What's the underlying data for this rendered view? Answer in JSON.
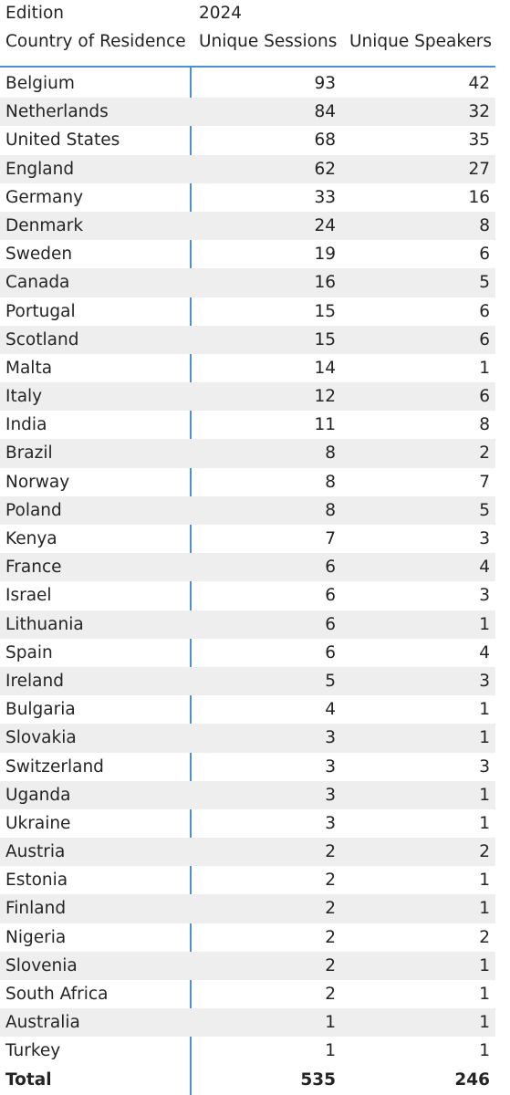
{
  "header": {
    "edition_label": "Edition",
    "edition_value": "2024",
    "columns": [
      "Country of Residence",
      "Unique Sessions",
      "Unique Speakers"
    ]
  },
  "colors": {
    "accent_line": "#4a90d9",
    "alt_row": "#eeeeee"
  },
  "rows": [
    {
      "country": "Belgium",
      "sessions": "93",
      "speakers": "42"
    },
    {
      "country": "Netherlands",
      "sessions": "84",
      "speakers": "32"
    },
    {
      "country": "United States",
      "sessions": "68",
      "speakers": "35"
    },
    {
      "country": "England",
      "sessions": "62",
      "speakers": "27"
    },
    {
      "country": "Germany",
      "sessions": "33",
      "speakers": "16"
    },
    {
      "country": "Denmark",
      "sessions": "24",
      "speakers": "8"
    },
    {
      "country": "Sweden",
      "sessions": "19",
      "speakers": "6"
    },
    {
      "country": "Canada",
      "sessions": "16",
      "speakers": "5"
    },
    {
      "country": "Portugal",
      "sessions": "15",
      "speakers": "6"
    },
    {
      "country": "Scotland",
      "sessions": "15",
      "speakers": "6"
    },
    {
      "country": "Malta",
      "sessions": "14",
      "speakers": "1"
    },
    {
      "country": "Italy",
      "sessions": "12",
      "speakers": "6"
    },
    {
      "country": "India",
      "sessions": "11",
      "speakers": "8"
    },
    {
      "country": "Brazil",
      "sessions": "8",
      "speakers": "2"
    },
    {
      "country": "Norway",
      "sessions": "8",
      "speakers": "7"
    },
    {
      "country": "Poland",
      "sessions": "8",
      "speakers": "5"
    },
    {
      "country": "Kenya",
      "sessions": "7",
      "speakers": "3"
    },
    {
      "country": "France",
      "sessions": "6",
      "speakers": "4"
    },
    {
      "country": "Israel",
      "sessions": "6",
      "speakers": "3"
    },
    {
      "country": "Lithuania",
      "sessions": "6",
      "speakers": "1"
    },
    {
      "country": "Spain",
      "sessions": "6",
      "speakers": "4"
    },
    {
      "country": "Ireland",
      "sessions": "5",
      "speakers": "3"
    },
    {
      "country": "Bulgaria",
      "sessions": "4",
      "speakers": "1"
    },
    {
      "country": "Slovakia",
      "sessions": "3",
      "speakers": "1"
    },
    {
      "country": "Switzerland",
      "sessions": "3",
      "speakers": "3"
    },
    {
      "country": "Uganda",
      "sessions": "3",
      "speakers": "1"
    },
    {
      "country": "Ukraine",
      "sessions": "3",
      "speakers": "1"
    },
    {
      "country": "Austria",
      "sessions": "2",
      "speakers": "2"
    },
    {
      "country": "Estonia",
      "sessions": "2",
      "speakers": "1"
    },
    {
      "country": "Finland",
      "sessions": "2",
      "speakers": "1"
    },
    {
      "country": "Nigeria",
      "sessions": "2",
      "speakers": "2"
    },
    {
      "country": "Slovenia",
      "sessions": "2",
      "speakers": "1"
    },
    {
      "country": "South Africa",
      "sessions": "2",
      "speakers": "1"
    },
    {
      "country": "Australia",
      "sessions": "1",
      "speakers": "1"
    },
    {
      "country": "Turkey",
      "sessions": "1",
      "speakers": "1"
    }
  ],
  "total": {
    "label": "Total",
    "sessions": "535",
    "speakers": "246"
  }
}
